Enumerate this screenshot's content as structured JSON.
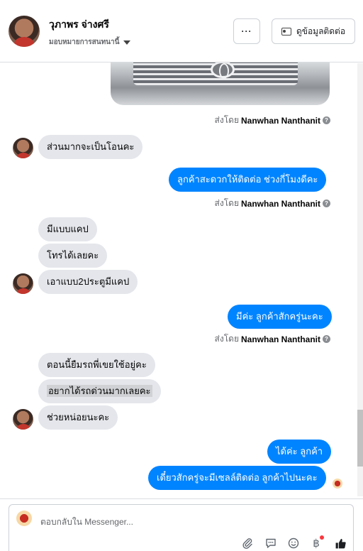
{
  "header": {
    "contact_name": "วุภาพร จ่างศรี",
    "assigned_label": "มอบหมายการสนทนานี้",
    "more_label": "···",
    "view_contact_label": "ดูข้อมูลติดต่อ"
  },
  "thread": {
    "sent_by_prefix": "ส่งโดย",
    "sender_name": "Nanwhan Nanthanit",
    "messages": [
      {
        "dir": "in",
        "text": "ส่วนมากจะเป็นโอนคะ"
      },
      {
        "dir": "out",
        "text": "ลูกค้าสะดวกให้ติดต่อ ช่วงกี่โมงดีคะ"
      },
      {
        "dir": "in",
        "text": "มีแบบแคป"
      },
      {
        "dir": "in",
        "text": "โทรได้เลยคะ"
      },
      {
        "dir": "in",
        "text": "เอาแบบ2ประตูมีแคป"
      },
      {
        "dir": "out",
        "text": "มีค่ะ ลูกค้าสักครู่นะคะ"
      },
      {
        "dir": "in",
        "text": "ตอนนี้ยืมรถพี่เขยใช้อยู่คะ"
      },
      {
        "dir": "in",
        "text": "อยากได้รถด่วนมากเลยคะ"
      },
      {
        "dir": "in",
        "text": "ช่วยหน่อยนะคะ"
      },
      {
        "dir": "out",
        "text": "ได้ค่ะ ลูกค้า"
      },
      {
        "dir": "out",
        "text": "เดี๋ยวสักครู่จะมีเซลล์ติดต่อ ลูกค้าไปนะคะ"
      }
    ]
  },
  "composer": {
    "placeholder": "ตอบกลับใน Messenger..."
  },
  "icons": {
    "attach": "paperclip-icon",
    "saved_replies": "chat-bubble-icon",
    "emoji": "smiley-icon",
    "payment": "baht-icon",
    "like": "thumbs-up-icon"
  },
  "colors": {
    "outgoing_bubble": "#0084ff",
    "incoming_bubble": "#e4e6eb",
    "notification_dot": "#fa383e"
  }
}
